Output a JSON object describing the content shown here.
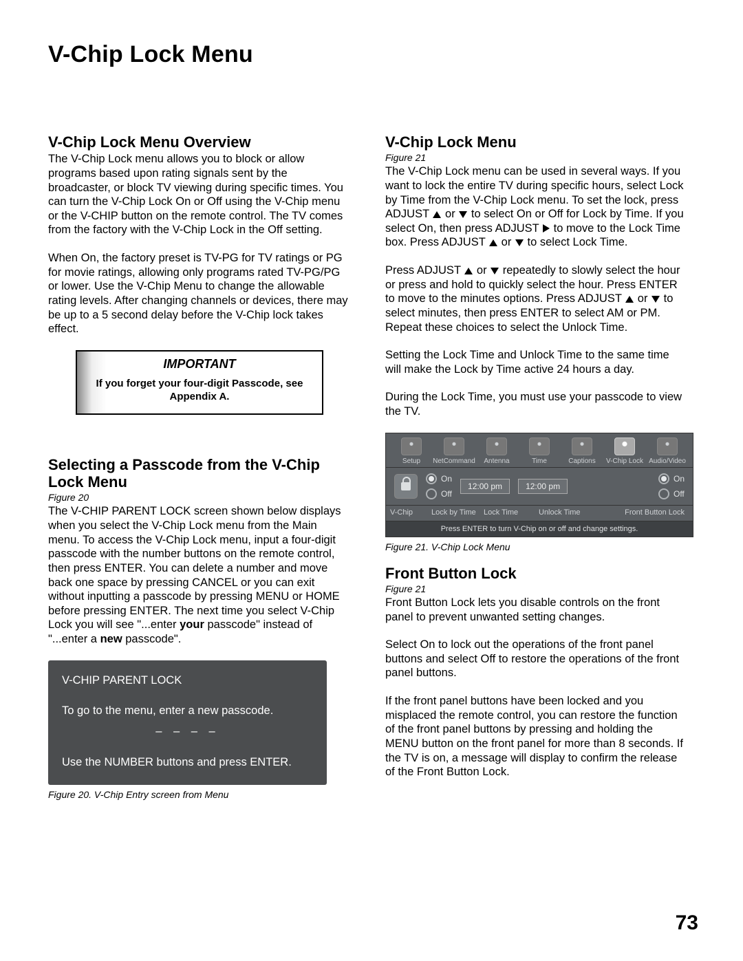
{
  "page_title": "V-Chip Lock Menu",
  "page_number": "73",
  "left": {
    "h_overview": "V-Chip Lock Menu Overview",
    "p_overview_1": "The V-Chip Lock menu allows you to block or allow programs based upon rating signals sent by the broadcaster, or block TV viewing during specific times.  You can turn the V-Chip Lock On or Off using the V-Chip menu or the V-CHIP button on the remote control.  The TV comes from the factory with the V-Chip Lock in the Off setting.",
    "p_overview_2": "When On, the factory preset is TV-PG for TV ratings or PG for movie ratings, allowing only programs rated TV-PG/PG or lower.  Use the V-Chip Menu to change the allowable rating levels.  After changing channels or devices, there may be up to a 5 second delay before the V-Chip lock takes effect.",
    "important_title": "IMPORTANT",
    "important_text": "If you forget your four-digit Passcode, see Appendix A.",
    "h_passcode": "Selecting a Passcode from the V-Chip Lock Menu",
    "fig20_ref": "Figure 20",
    "p_passcode_pre": "The V-CHIP PARENT LOCK screen shown below displays when you select the V-Chip Lock menu from the Main menu.  To access the V-Chip Lock menu, input a four-digit passcode with the number buttons on the remote control, then press ENTER.  You can delete a number and move back one space by pressing CANCEL or you can exit without inputting a passcode by pressing MENU or HOME before pressing ENTER. The next time you select V-Chip Lock you will see \"...enter ",
    "p_passcode_bold1": "your",
    "p_passcode_mid": " passcode\" instead of \"...enter a ",
    "p_passcode_bold2": "new",
    "p_passcode_post": " passcode\".",
    "pass_title": "V-CHIP PARENT LOCK",
    "pass_line1": "To go to the menu, enter a new passcode.",
    "pass_dashes": "– – – –",
    "pass_line2": "Use the NUMBER buttons and press ENTER.",
    "caption20": "Figure 20. V-Chip Entry screen from Menu"
  },
  "right": {
    "h_menu": "V-Chip Lock Menu",
    "fig21_ref_a": "Figure 21",
    "p_menu_1a": "The V-Chip Lock menu can be used in several ways. If you want to lock the entire TV during specific hours, select Lock by Time from the V-Chip Lock menu.   To set the lock, press ADJUST ",
    "p_menu_1b": " or ",
    "p_menu_1c": " to select On or Off for Lock by Time.  If you select On, then press ADJUST ",
    "p_menu_1d": " to move to the Lock Time box.  Press ADJUST ",
    "p_menu_1e": " or ",
    "p_menu_1f": " to select Lock Time.",
    "p_menu_2a": "Press ADJUST ",
    "p_menu_2b": " or ",
    "p_menu_2c": "  repeatedly to slowly select the hour or press and hold to quickly select the hour.  Press ENTER to move to the minutes options.  Press ADJUST ",
    "p_menu_2d": " or ",
    "p_menu_2e": " to select minutes, then press ENTER to select AM or PM.  Repeat these choices to select the Unlock Time.",
    "p_menu_3": "Setting the Lock Time and Unlock Time to the same time will make the Lock by Time active 24 hours a day.",
    "p_menu_4": "During the Lock Time, you must use your passcode to view the TV.",
    "caption21": "Figure 21. V-Chip Lock Menu",
    "h_front": "Front Button Lock",
    "fig21_ref_b": "Figure 21",
    "p_front_1": "Front Button Lock lets you disable controls on the front panel to prevent unwanted setting changes.",
    "p_front_2": "Select On to lock out the operations of the front panel buttons and select Off to restore the operations of the front panel buttons.",
    "p_front_3": "If the front panel buttons have been locked and you misplaced the remote control, you can restore the function of the front panel buttons by pressing and holding the MENU button on the front panel for more than 8 seconds.  If the TV is on, a message will display to confirm the release of the Front Button Lock."
  },
  "menu": {
    "top": [
      "Setup",
      "NetCommand",
      "Antenna",
      "Time",
      "Captions",
      "V-Chip Lock",
      "Audio/Video"
    ],
    "on": "On",
    "off": "Off",
    "t1": "12:00 pm",
    "t2": "12:00 pm",
    "labels": [
      "V-Chip",
      "Lock by Time",
      "Lock Time",
      "Unlock Time",
      "Front Button Lock"
    ],
    "footer": "Press ENTER to turn V-Chip on or off and change settings."
  }
}
